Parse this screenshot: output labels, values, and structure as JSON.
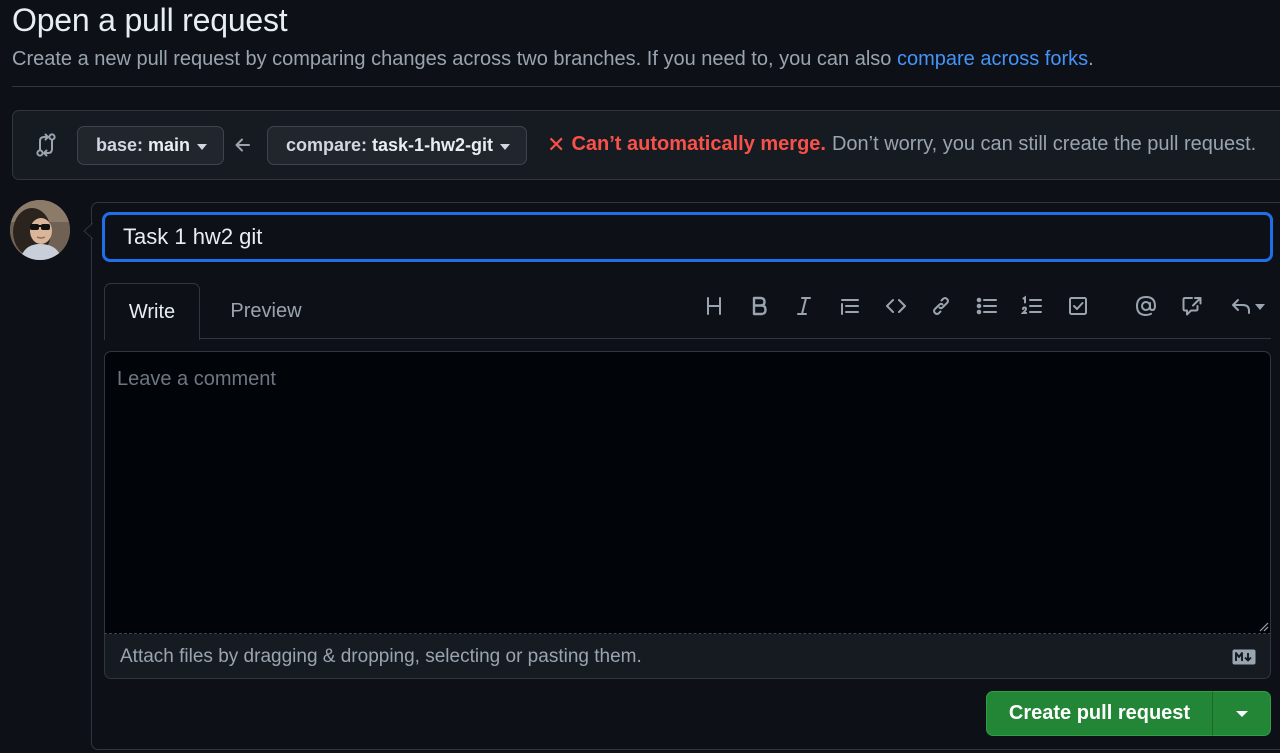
{
  "page": {
    "title": "Open a pull request",
    "subtitle_text": "Create a new pull request by comparing changes across two branches. If you need to, you can also ",
    "subtitle_link": "compare across forks",
    "subtitle_end": "."
  },
  "range": {
    "base_label": "base:",
    "base_value": "main",
    "compare_label": "compare:",
    "compare_value": "task-1-hw2-git",
    "merge_icon": "x-icon",
    "merge_glyph": "✕",
    "merge_status": "Can’t automatically merge.",
    "merge_note": "Don’t worry, you can still create the pull request."
  },
  "composer": {
    "title_value": "Task 1 hw2 git",
    "tabs": [
      {
        "label": "Write"
      },
      {
        "label": "Preview"
      }
    ],
    "toolbar": [
      "heading-icon",
      "bold-icon",
      "italic-icon",
      "quote-icon",
      "code-icon",
      "link-icon",
      "unordered-list-icon",
      "ordered-list-icon",
      "task-list-icon",
      "mention-icon",
      "cross-reference-icon",
      "reply-icon"
    ],
    "comment_placeholder": "Leave a comment",
    "attach_text": "Attach files by dragging & dropping, selecting or pasting them.",
    "submit_label": "Create pull request"
  },
  "colors": {
    "background": "#0d1117",
    "accent_link": "#4493f8",
    "error": "#f85149",
    "primary_button": "#238636",
    "focus": "#1f6feb"
  }
}
